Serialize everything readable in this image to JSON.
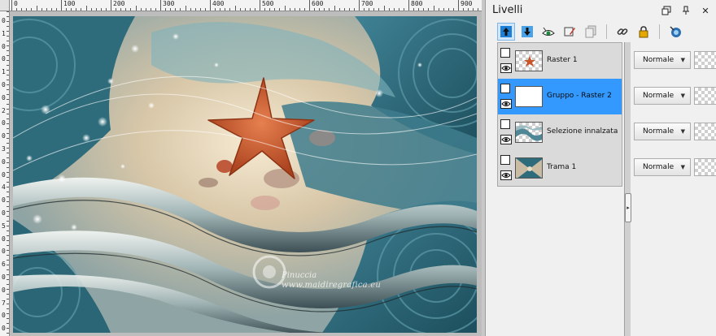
{
  "rulers": {
    "horizontal": [
      "0",
      "100",
      "200",
      "300",
      "400",
      "500",
      "600",
      "700",
      "800",
      "900"
    ],
    "vertical": [
      "0",
      "1",
      "0",
      "0",
      "1",
      "0",
      "0",
      "2",
      "0",
      "0",
      "3",
      "0",
      "0",
      "4",
      "0",
      "0",
      "5",
      "0",
      "0",
      "6",
      "0",
      "0",
      "7",
      "0",
      "0"
    ]
  },
  "canvas": {
    "watermark_name": "Pinuccia",
    "watermark_url": "www.maidiregrafica.eu"
  },
  "panel": {
    "title": "Livelli",
    "controls": [
      "restore-icon",
      "pin-icon",
      "close-icon"
    ],
    "close_glyph": "✕"
  },
  "layers": [
    {
      "name": "Raster 1",
      "blend": "Normale",
      "thumb": "starfish",
      "active": false
    },
    {
      "name": "Gruppo - Raster 2",
      "blend": "Normale",
      "thumb": "empty",
      "active": true
    },
    {
      "name": "Selezione innalzata",
      "blend": "Normale",
      "thumb": "waves",
      "active": false
    },
    {
      "name": "Trama 1",
      "blend": "Normale",
      "thumb": "pattern",
      "active": false
    }
  ],
  "colors": {
    "active_layer": "#3399ff",
    "teal": "#2d6878",
    "sand": "#d9cdb7",
    "starfish": "#c8562a"
  }
}
